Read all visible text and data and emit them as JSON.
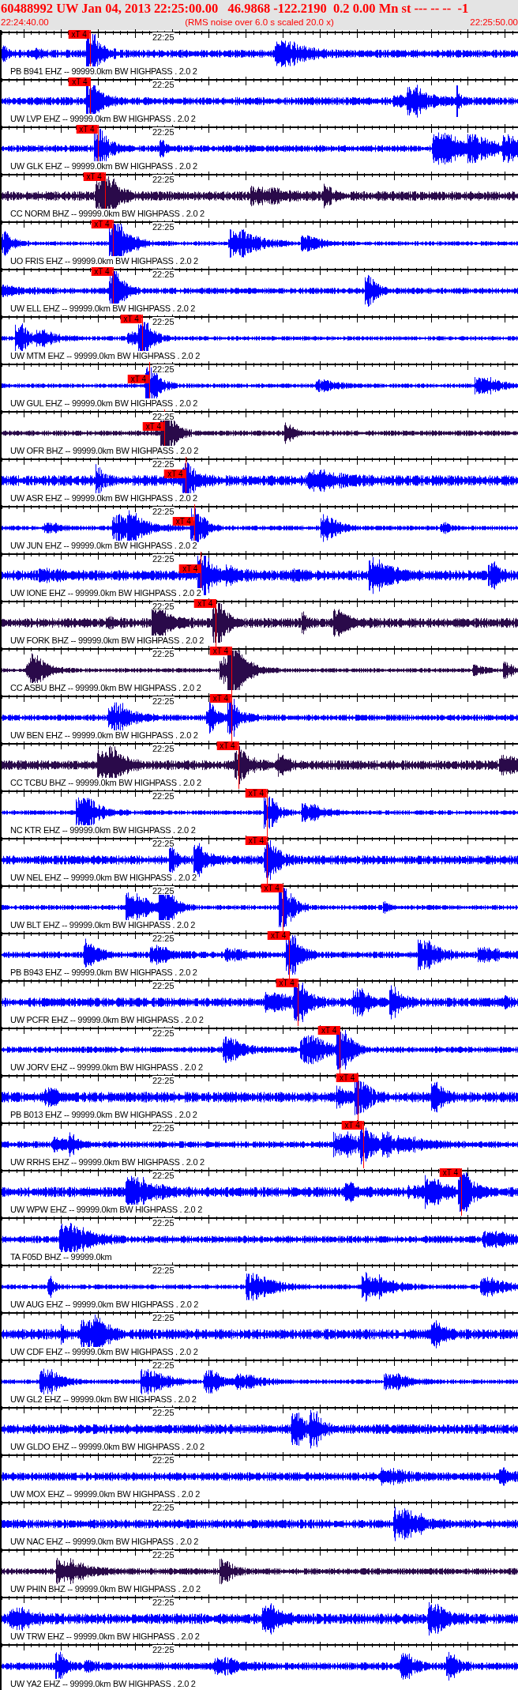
{
  "header": {
    "title": "60488992 UW Jan 04, 2013 22:25:00.00   46.9868 -122.2190  0.2 0.00 Mn st --- -- --  -1",
    "start_time": "22:24:40.00",
    "note": "(RMS noise over 6.0 s scaled 20.0 x)",
    "end_time": "22:25:50.00"
  },
  "traces": [
    {
      "label": "PB B941 EHZ -- 99999.0km BW HIGHPASS . 2.0 2",
      "time_mark": "22:25",
      "pick": "xT 4",
      "color": "#0000ff"
    },
    {
      "label": "UW LVP EHZ -- 99999.0km BW HIGHPASS . 2.0 2",
      "time_mark": "22:25",
      "pick": "xT 4",
      "color": "#0000ff"
    },
    {
      "label": "UW GLK EHZ -- 99999.0km BW HIGHPASS . 2.0 2",
      "time_mark": "22:25",
      "pick": "xT 4",
      "color": "#0000ff"
    },
    {
      "label": "CC NORM BHZ -- 99999.0km BW HIGHPASS . 2.0 2",
      "time_mark": "22:25",
      "pick": "xT 4",
      "color": "#2a0a4a"
    },
    {
      "label": "UO FRIS EHZ -- 99999.0km BW HIGHPASS . 2.0 2",
      "time_mark": "22:25",
      "pick": "xT 4",
      "color": "#0000ff"
    },
    {
      "label": "UW ELL EHZ -- 99999.0km BW HIGHPASS . 2.0 2",
      "time_mark": "22:25",
      "pick": "xT 4",
      "color": "#0000ff"
    },
    {
      "label": "UW MTM EHZ -- 99999.0km BW HIGHPASS . 2.0 2",
      "time_mark": "22:25",
      "pick": "xT 4",
      "color": "#0000ff"
    },
    {
      "label": "UW GUL EHZ -- 99999.0km BW HIGHPASS . 2.0 2",
      "time_mark": "22:25",
      "pick": "xT 4",
      "color": "#0000ff"
    },
    {
      "label": "UW OFR BHZ -- 99999.0km BW HIGHPASS . 2.0 2",
      "time_mark": "22:25",
      "pick": "xT 4",
      "color": "#2a0a4a"
    },
    {
      "label": "UW ASR EHZ -- 99999.0km BW HIGHPASS . 2.0 2",
      "time_mark": "22:25",
      "pick": "xT 4",
      "color": "#0000ff"
    },
    {
      "label": "UW JUN EHZ -- 99999.0km BW HIGHPASS . 2.0 2",
      "time_mark": "22:25",
      "pick": "xT 4",
      "color": "#0000ff"
    },
    {
      "label": "UW IONE EHZ -- 99999.0km BW HIGHPASS . 2.0 2",
      "time_mark": "22:25",
      "pick": "xT 4",
      "color": "#0000ff"
    },
    {
      "label": "UW FORK BHZ -- 99999.0km BW HIGHPASS . 2.0 2",
      "time_mark": "22:25",
      "pick": "xT 4",
      "color": "#2a0a4a"
    },
    {
      "label": "CC ASBU BHZ -- 99999.0km BW HIGHPASS . 2.0 2",
      "time_mark": "22:25",
      "pick": "xT 4",
      "color": "#2a0a4a"
    },
    {
      "label": "UW BEN EHZ -- 99999.0km BW HIGHPASS . 2.0 2",
      "time_mark": "22:25",
      "pick": "xT 4",
      "color": "#0000ff"
    },
    {
      "label": "CC TCBU BHZ -- 99999.0km BW HIGHPASS . 2.0 2",
      "time_mark": "22:25",
      "pick": "xT 4",
      "color": "#2a0a4a"
    },
    {
      "label": "NC KTR EHZ -- 99999.0km BW HIGHPASS . 2.0 2",
      "time_mark": "22:25",
      "pick": "xT 4",
      "color": "#0000ff"
    },
    {
      "label": "UW NEL EHZ -- 99999.0km BW HIGHPASS . 2.0 2",
      "time_mark": "22:25",
      "pick": "xT 4",
      "color": "#0000ff"
    },
    {
      "label": "UW BLT EHZ -- 99999.0km BW HIGHPASS . 2.0 2",
      "time_mark": "22:25",
      "pick": "xT 4",
      "color": "#0000ff"
    },
    {
      "label": "PB B943 EHZ -- 99999.0km BW HIGHPASS . 2.0 2",
      "time_mark": "22:25",
      "pick": "xT 4",
      "color": "#0000ff"
    },
    {
      "label": "UW PCFR EHZ -- 99999.0km BW HIGHPASS . 2.0 2",
      "time_mark": "22:25",
      "pick": "xT 4",
      "color": "#0000ff"
    },
    {
      "label": "UW JORV EHZ -- 99999.0km BW HIGHPASS . 2.0 2",
      "time_mark": "22:25",
      "pick": "xT 4",
      "color": "#0000ff"
    },
    {
      "label": "PB B013 EHZ -- 99999.0km BW HIGHPASS . 2.0 2",
      "time_mark": "22:25",
      "pick": "xT 4",
      "color": "#0000ff"
    },
    {
      "label": "UW RRHS EHZ -- 99999.0km BW HIGHPASS . 2.0 2",
      "time_mark": "22:25",
      "pick": "xT 4",
      "color": "#0000ff"
    },
    {
      "label": "UW WPW EHZ -- 99999.0km BW HIGHPASS . 2.0 2",
      "time_mark": "22:25",
      "pick": "xT 4",
      "color": "#0000ff"
    },
    {
      "label": "TA F05D BHZ -- 99999.0km",
      "time_mark": "22:25",
      "color": "#0000ff"
    },
    {
      "label": "UW AUG EHZ -- 99999.0km BW HIGHPASS . 2.0 2",
      "time_mark": "22:25",
      "color": "#0000ff"
    },
    {
      "label": "UW CDF EHZ -- 99999.0km BW HIGHPASS . 2.0 2",
      "time_mark": "22:25",
      "color": "#0000ff"
    },
    {
      "label": "UW GL2 EHZ -- 99999.0km BW HIGHPASS . 2.0 2",
      "time_mark": "22:25",
      "color": "#0000ff"
    },
    {
      "label": "UW GLDO EHZ -- 99999.0km BW HIGHPASS . 2.0 2",
      "time_mark": "22:25",
      "color": "#0000ff"
    },
    {
      "label": "UW MOX EHZ -- 99999.0km BW HIGHPASS . 2.0 2",
      "time_mark": "22:25",
      "color": "#0000ff"
    },
    {
      "label": "UW NAC EHZ -- 99999.0km BW HIGHPASS . 2.0 2",
      "time_mark": "22:25",
      "color": "#0000ff"
    },
    {
      "label": "UW PHIN BHZ -- 99999.0km BW HIGHPASS . 2.0 2",
      "time_mark": "22:25",
      "color": "#2a0a4a"
    },
    {
      "label": "UW TRW EHZ -- 99999.0km BW HIGHPASS . 2.0 2",
      "time_mark": "22:25",
      "color": "#0000ff"
    },
    {
      "label": "UW YA2 EHZ -- 99999.0km BW HIGHPASS . 2.0 2",
      "time_mark": "22:25",
      "color": "#0000ff"
    }
  ]
}
